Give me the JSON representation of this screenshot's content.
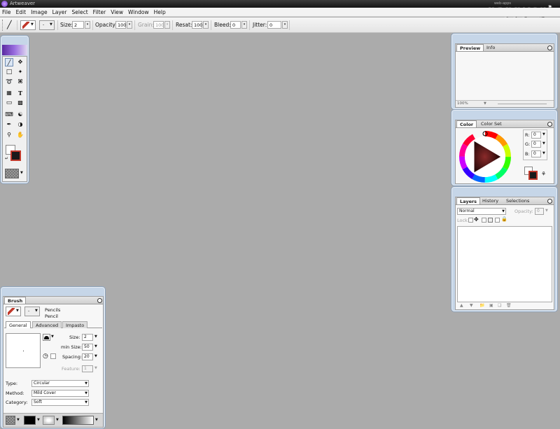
{
  "titlebar": {
    "title": "Artweaver"
  },
  "watermark": {
    "text": "nappycgi",
    "small": "web-apps"
  },
  "menubar": {
    "items": [
      "File",
      "Edit",
      "Image",
      "Layer",
      "Select",
      "Filter",
      "View",
      "Window",
      "Help"
    ]
  },
  "options_bar": {
    "size_label": "Size:",
    "size_value": "2",
    "opacity_label": "Opacity:",
    "opacity_value": "100",
    "grain_label": "Grain:",
    "grain_value": "100",
    "resat_label": "Resat:",
    "resat_value": "100",
    "bleed_label": "Bleed:",
    "bleed_value": "0",
    "jitter_label": "Jitter:",
    "jitter_value": "0",
    "variant_value": "-"
  },
  "preview_panel": {
    "tabs": [
      "Preview",
      "Info"
    ],
    "zoom": "100%"
  },
  "color_panel": {
    "tabs": [
      "Color",
      "Color Set"
    ],
    "r_label": "R:",
    "r_value": "0",
    "g_label": "G:",
    "g_value": "0",
    "b_label": "B:",
    "b_value": "0"
  },
  "layers_panel": {
    "tabs": [
      "Layers",
      "History",
      "Selections"
    ],
    "blend_mode": "Normal",
    "opacity_label": "Opacity:",
    "opacity_value": "0",
    "lock_label": "Lock:"
  },
  "brush_panel": {
    "title": "Brush",
    "category_name": "Pencils",
    "variant_name": "Pencil",
    "variant_value": "-",
    "tabs": [
      "General",
      "Advanced",
      "Impasto"
    ],
    "size_label": "Size:",
    "size_value": "2",
    "min_size_label": "min Size:",
    "min_size_value": "50",
    "spacing_label": "Spacing:",
    "spacing_value": "20",
    "feature_label": "Feature:",
    "feature_value": "1",
    "type_label": "Type:",
    "type_value": "Circular",
    "method_label": "Method:",
    "method_value": "Mild Cover",
    "category_label": "Category:",
    "category_value": "Soft"
  },
  "colors": {
    "foreground": "#1a1a1a",
    "background": "#ffffff",
    "accent_red": "#c0392b",
    "canvas": "#ababab",
    "panel_frame": "#c6d6e8"
  }
}
